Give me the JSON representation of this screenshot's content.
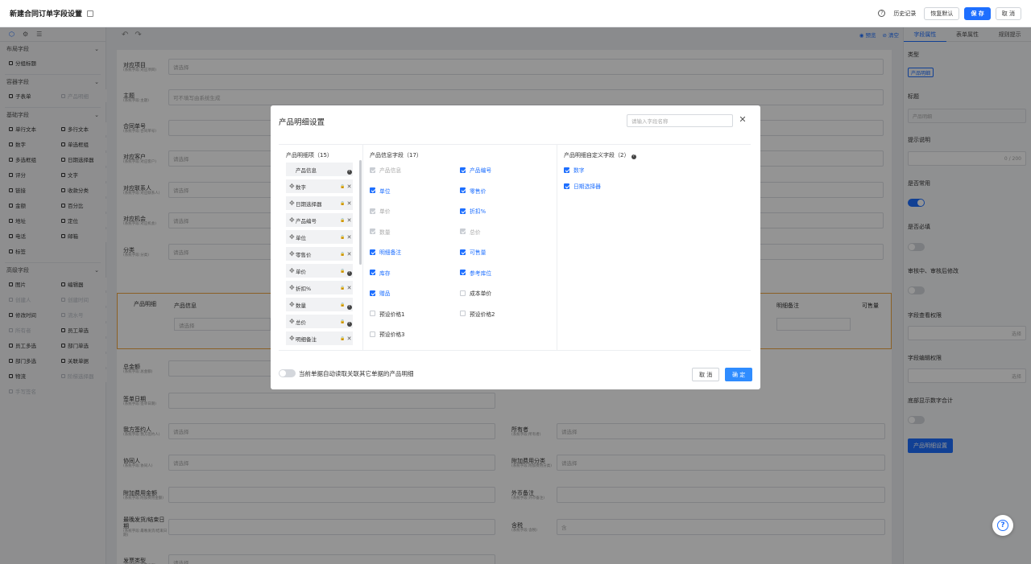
{
  "header": {
    "title": "新建合同订单字段设置",
    "help_icon": "?",
    "history_label": "历史记录",
    "restore_label": "恢复默认",
    "save_label": "保 存",
    "cancel_label": "取 消"
  },
  "left_panel": {
    "sections": [
      {
        "title": "布局字段",
        "items": [
          {
            "label": "分组标题",
            "disabled": false
          }
        ]
      },
      {
        "title": "容器字段",
        "items": [
          {
            "label": "子表单",
            "disabled": false
          },
          {
            "label": "产品明细",
            "disabled": true
          }
        ]
      },
      {
        "title": "基础字段",
        "items": [
          {
            "label": "单行文本",
            "disabled": false
          },
          {
            "label": "多行文本",
            "disabled": false
          },
          {
            "label": "数字",
            "disabled": false
          },
          {
            "label": "单选框组",
            "disabled": false
          },
          {
            "label": "多选框组",
            "disabled": false
          },
          {
            "label": "日期选择器",
            "disabled": false
          },
          {
            "label": "评分",
            "disabled": false
          },
          {
            "label": "文字",
            "disabled": false
          },
          {
            "label": "链接",
            "disabled": false
          },
          {
            "label": "收款分类",
            "disabled": false
          },
          {
            "label": "金额",
            "disabled": false
          },
          {
            "label": "百分比",
            "disabled": false
          },
          {
            "label": "地址",
            "disabled": false
          },
          {
            "label": "定位",
            "disabled": false
          },
          {
            "label": "电话",
            "disabled": false
          },
          {
            "label": "邮箱",
            "disabled": false
          },
          {
            "label": "标签",
            "disabled": false
          }
        ]
      },
      {
        "title": "高级字段",
        "items": [
          {
            "label": "图片",
            "disabled": false
          },
          {
            "label": "编辑器",
            "disabled": false
          },
          {
            "label": "创建人",
            "disabled": true
          },
          {
            "label": "创建时间",
            "disabled": true
          },
          {
            "label": "修改时间",
            "disabled": false
          },
          {
            "label": "流水号",
            "disabled": true
          },
          {
            "label": "所有者",
            "disabled": true
          },
          {
            "label": "员工单选",
            "disabled": false
          },
          {
            "label": "员工多选",
            "disabled": false
          },
          {
            "label": "部门单选",
            "disabled": false
          },
          {
            "label": "部门多选",
            "disabled": false
          },
          {
            "label": "关联单据",
            "disabled": false
          },
          {
            "label": "物流",
            "disabled": false
          },
          {
            "label": "阶梯选择器",
            "disabled": true
          },
          {
            "label": "手写签名",
            "disabled": true
          }
        ]
      }
    ]
  },
  "canvas": {
    "preview_label": "预览",
    "clear_label": "清空",
    "fields": [
      {
        "label": "对应项目",
        "sub": "(系统字段:对应项目)",
        "placeholder": "请选择"
      },
      {
        "label": "主题",
        "sub": "(系统字段:主题)",
        "placeholder": "可不填写由系统生成"
      },
      {
        "label": "合同单号",
        "sub": "(系统字段:合同单号)",
        "placeholder": ""
      },
      {
        "label": "对应客户",
        "sub": "(系统字段:对应客户)",
        "placeholder": "请选择"
      },
      {
        "label": "对应联系人",
        "sub": "(系统字段:对应联系人)",
        "placeholder": "请选择"
      },
      {
        "label": "对应机会",
        "sub": "(系统字段:对应机会)",
        "placeholder": "请选择"
      },
      {
        "label": "分类",
        "sub": "(系统字段:分类)",
        "placeholder": "请选择"
      }
    ],
    "product_row": {
      "label": "产品明细",
      "col1": "产品信息",
      "col1_placeholder": "请选择",
      "col_note": "明细备注",
      "col_sell": "可售量"
    },
    "lower_left": [
      {
        "label": "总金额",
        "sub": "(系统字段:总金额)",
        "placeholder": ""
      },
      {
        "label": "签单日期",
        "sub": "(系统字段:签单日期)",
        "placeholder": ""
      },
      {
        "label": "我方签约人",
        "sub": "(系统字段:我方签约人)",
        "placeholder": "请选择"
      },
      {
        "label": "协同人",
        "sub": "(系统字段:协同人)",
        "placeholder": "请选择"
      },
      {
        "label": "附加费用金额",
        "sub": "(系统字段:附加费用金额)",
        "placeholder": ""
      },
      {
        "label": "最晚发货/结束日期",
        "sub": "(系统字段:最晚发货/结束日期)",
        "placeholder": ""
      },
      {
        "label": "发票类型",
        "sub": "(系统字段:发票类型)",
        "placeholder": "请选择"
      }
    ],
    "lower_right": [
      {
        "label": "所有者",
        "sub": "(系统字段:所有者)",
        "placeholder": "请选择"
      },
      {
        "label": "附加费用分类",
        "sub": "(系统字段:附加费用分类)",
        "placeholder": "请选择"
      },
      {
        "label": "外币备注",
        "sub": "(系统字段:外币备注)",
        "placeholder": ""
      },
      {
        "label": "含税",
        "sub": "(系统字段:含税)",
        "placeholder": "含"
      }
    ]
  },
  "right_panel": {
    "tabs": [
      "字段属性",
      "表单属性",
      "规则提示"
    ],
    "type_label": "类型",
    "type_value": "产品明细",
    "title_label": "标题",
    "title_value": "产品明细",
    "hint_label": "提示说明",
    "hint_count": "0 / 200",
    "common_label": "是否常用",
    "required_label": "是否必填",
    "audit_label": "审核中、审核后修改",
    "view_perm_label": "字段查看权限",
    "edit_perm_label": "字段编辑权限",
    "select_placeholder": "选择",
    "bottom_sum_label": "底部显示数字合计",
    "settings_button": "产品明细设置"
  },
  "modal": {
    "title": "产品明细设置",
    "search_placeholder": "请输入字段名称",
    "col1_title": "产品明细项（15）",
    "col2_title": "产品信息字段（17）",
    "col3_title": "产品明细自定义字段（2）",
    "detail_items": [
      {
        "label": "产品信息",
        "fixed": true
      },
      {
        "label": "数字",
        "fixed": false
      },
      {
        "label": "日期选择器",
        "fixed": false
      },
      {
        "label": "产品编号",
        "fixed": false
      },
      {
        "label": "单位",
        "fixed": false
      },
      {
        "label": "零售价",
        "fixed": false
      },
      {
        "label": "单价",
        "fixed": true
      },
      {
        "label": "折扣%",
        "fixed": false
      },
      {
        "label": "数量",
        "fixed": true
      },
      {
        "label": "总价",
        "fixed": true
      },
      {
        "label": "明细备注",
        "fixed": false
      }
    ],
    "product_fields": [
      {
        "label": "产品信息",
        "checked": true,
        "disabled": true
      },
      {
        "label": "产品编号",
        "checked": true,
        "disabled": false
      },
      {
        "label": "单位",
        "checked": true,
        "disabled": false
      },
      {
        "label": "零售价",
        "checked": true,
        "disabled": false
      },
      {
        "label": "单价",
        "checked": true,
        "disabled": true
      },
      {
        "label": "折扣%",
        "checked": true,
        "disabled": false
      },
      {
        "label": "数量",
        "checked": true,
        "disabled": true
      },
      {
        "label": "总价",
        "checked": true,
        "disabled": true
      },
      {
        "label": "明细备注",
        "checked": true,
        "disabled": false
      },
      {
        "label": "可售量",
        "checked": true,
        "disabled": false
      },
      {
        "label": "库存",
        "checked": true,
        "disabled": false
      },
      {
        "label": "参考库位",
        "checked": true,
        "disabled": false
      },
      {
        "label": "赠品",
        "checked": true,
        "disabled": false
      },
      {
        "label": "成本单价",
        "checked": false,
        "disabled": false
      },
      {
        "label": "预设价格1",
        "checked": false,
        "disabled": false
      },
      {
        "label": "预设价格2",
        "checked": false,
        "disabled": false
      },
      {
        "label": "预设价格3",
        "checked": false,
        "disabled": false
      }
    ],
    "custom_fields": [
      {
        "label": "数字",
        "checked": true
      },
      {
        "label": "日期选择器",
        "checked": true
      }
    ],
    "auto_read_label": "当前单据自动读取关联其它单据的产品明细",
    "cancel_label": "取 消",
    "ok_label": "确 定"
  }
}
